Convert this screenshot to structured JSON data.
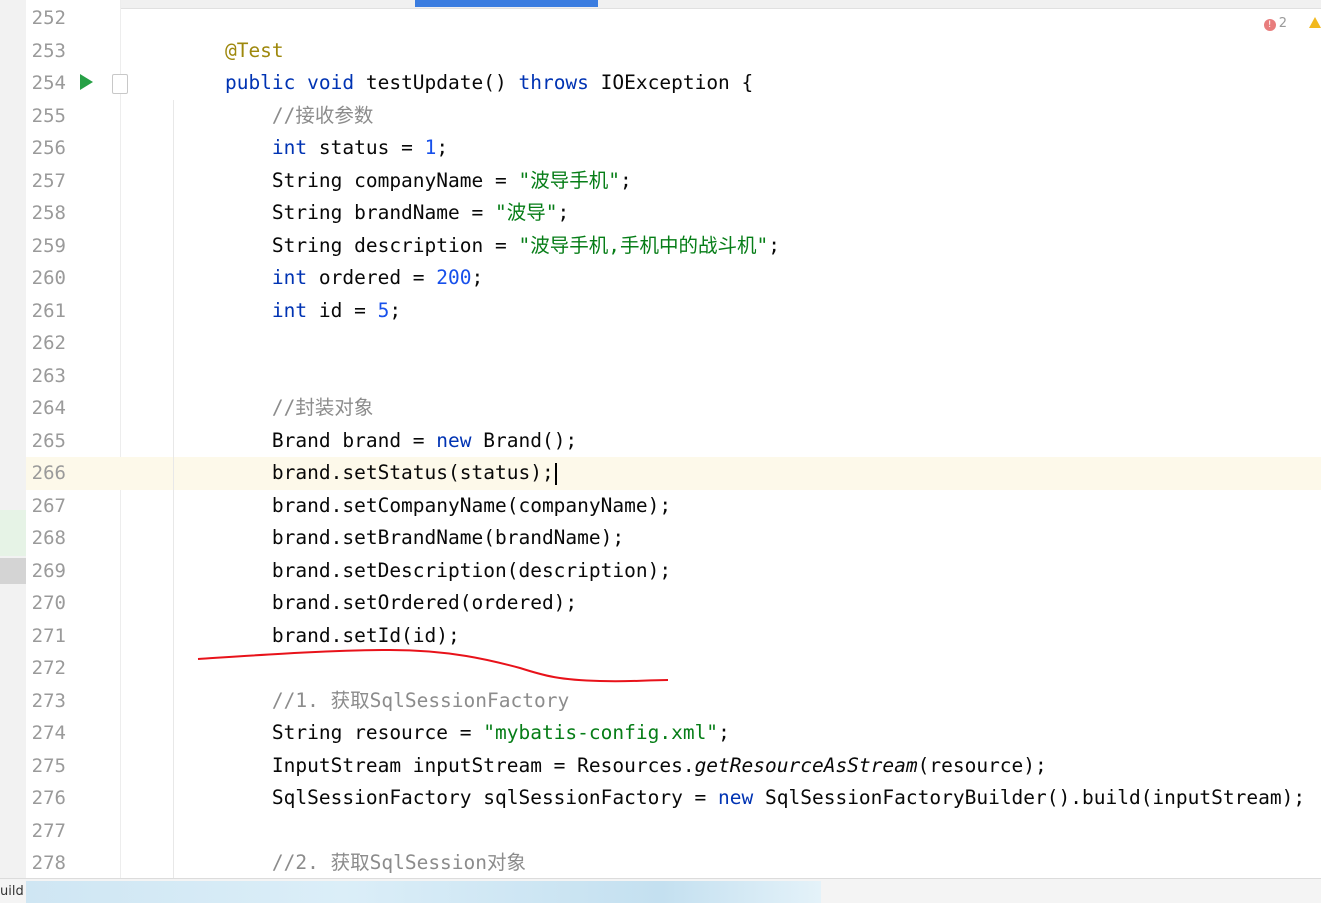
{
  "editor": {
    "inspection_count": "2",
    "bottom_label": "uild",
    "current_line": "266",
    "lines": [
      {
        "n": "252",
        "t": []
      },
      {
        "n": "253",
        "t": [
          {
            "c": "ann",
            "v": "    @Test"
          }
        ]
      },
      {
        "n": "254",
        "t": [
          {
            "c": "kw",
            "v": "    public void "
          },
          {
            "c": "",
            "v": "testUpdate() "
          },
          {
            "c": "kw",
            "v": "throws "
          },
          {
            "c": "",
            "v": "IOException {"
          }
        ]
      },
      {
        "n": "255",
        "t": [
          {
            "c": "cmt",
            "v": "        //接收参数"
          }
        ]
      },
      {
        "n": "256",
        "t": [
          {
            "c": "kw",
            "v": "        int "
          },
          {
            "c": "",
            "v": "status = "
          },
          {
            "c": "num",
            "v": "1"
          },
          {
            "c": "",
            "v": ";"
          }
        ]
      },
      {
        "n": "257",
        "t": [
          {
            "c": "",
            "v": "        String companyName = "
          },
          {
            "c": "str",
            "v": "\"波导手机\""
          },
          {
            "c": "",
            "v": ";"
          }
        ]
      },
      {
        "n": "258",
        "t": [
          {
            "c": "",
            "v": "        String brandName = "
          },
          {
            "c": "str",
            "v": "\"波导\""
          },
          {
            "c": "",
            "v": ";"
          }
        ]
      },
      {
        "n": "259",
        "t": [
          {
            "c": "",
            "v": "        String description = "
          },
          {
            "c": "str",
            "v": "\"波导手机,手机中的战斗机\""
          },
          {
            "c": "",
            "v": ";"
          }
        ]
      },
      {
        "n": "260",
        "t": [
          {
            "c": "kw",
            "v": "        int "
          },
          {
            "c": "",
            "v": "ordered = "
          },
          {
            "c": "num",
            "v": "200"
          },
          {
            "c": "",
            "v": ";"
          }
        ]
      },
      {
        "n": "261",
        "t": [
          {
            "c": "kw",
            "v": "        int "
          },
          {
            "c": "",
            "v": "id = "
          },
          {
            "c": "num",
            "v": "5"
          },
          {
            "c": "",
            "v": ";"
          }
        ]
      },
      {
        "n": "262",
        "t": []
      },
      {
        "n": "263",
        "t": []
      },
      {
        "n": "264",
        "t": [
          {
            "c": "cmt",
            "v": "        //封装对象"
          }
        ]
      },
      {
        "n": "265",
        "t": [
          {
            "c": "",
            "v": "        Brand brand = "
          },
          {
            "c": "kw",
            "v": "new "
          },
          {
            "c": "",
            "v": "Brand();"
          }
        ]
      },
      {
        "n": "266",
        "t": [
          {
            "c": "",
            "v": "        brand.setStatus(status);"
          }
        ],
        "caret": true
      },
      {
        "n": "267",
        "t": [
          {
            "c": "",
            "v": "        brand.setCompanyName(companyName);"
          }
        ]
      },
      {
        "n": "268",
        "t": [
          {
            "c": "",
            "v": "        brand.setBrandName(brandName);"
          }
        ]
      },
      {
        "n": "269",
        "t": [
          {
            "c": "",
            "v": "        brand.setDescription(description);"
          }
        ]
      },
      {
        "n": "270",
        "t": [
          {
            "c": "",
            "v": "        brand.setOrdered(ordered);"
          }
        ]
      },
      {
        "n": "271",
        "t": [
          {
            "c": "",
            "v": "        brand.setId(id);"
          }
        ]
      },
      {
        "n": "272",
        "t": []
      },
      {
        "n": "273",
        "t": [
          {
            "c": "cmt",
            "v": "        //1. 获取SqlSessionFactory"
          }
        ]
      },
      {
        "n": "274",
        "t": [
          {
            "c": "",
            "v": "        String resource = "
          },
          {
            "c": "str",
            "v": "\"mybatis-config.xml\""
          },
          {
            "c": "",
            "v": ";"
          }
        ]
      },
      {
        "n": "275",
        "t": [
          {
            "c": "",
            "v": "        InputStream inputStream = Resources."
          },
          {
            "c": "it",
            "v": "getResourceAsStream"
          },
          {
            "c": "",
            "v": "(resource);"
          }
        ]
      },
      {
        "n": "276",
        "t": [
          {
            "c": "",
            "v": "        SqlSessionFactory sqlSessionFactory = "
          },
          {
            "c": "kw",
            "v": "new "
          },
          {
            "c": "",
            "v": "SqlSessionFactoryBuilder().build(inputStream);"
          }
        ]
      },
      {
        "n": "277",
        "t": []
      },
      {
        "n": "278",
        "t": [
          {
            "c": "cmt",
            "v": "        //2. 获取SqlSession对象"
          }
        ]
      }
    ]
  }
}
